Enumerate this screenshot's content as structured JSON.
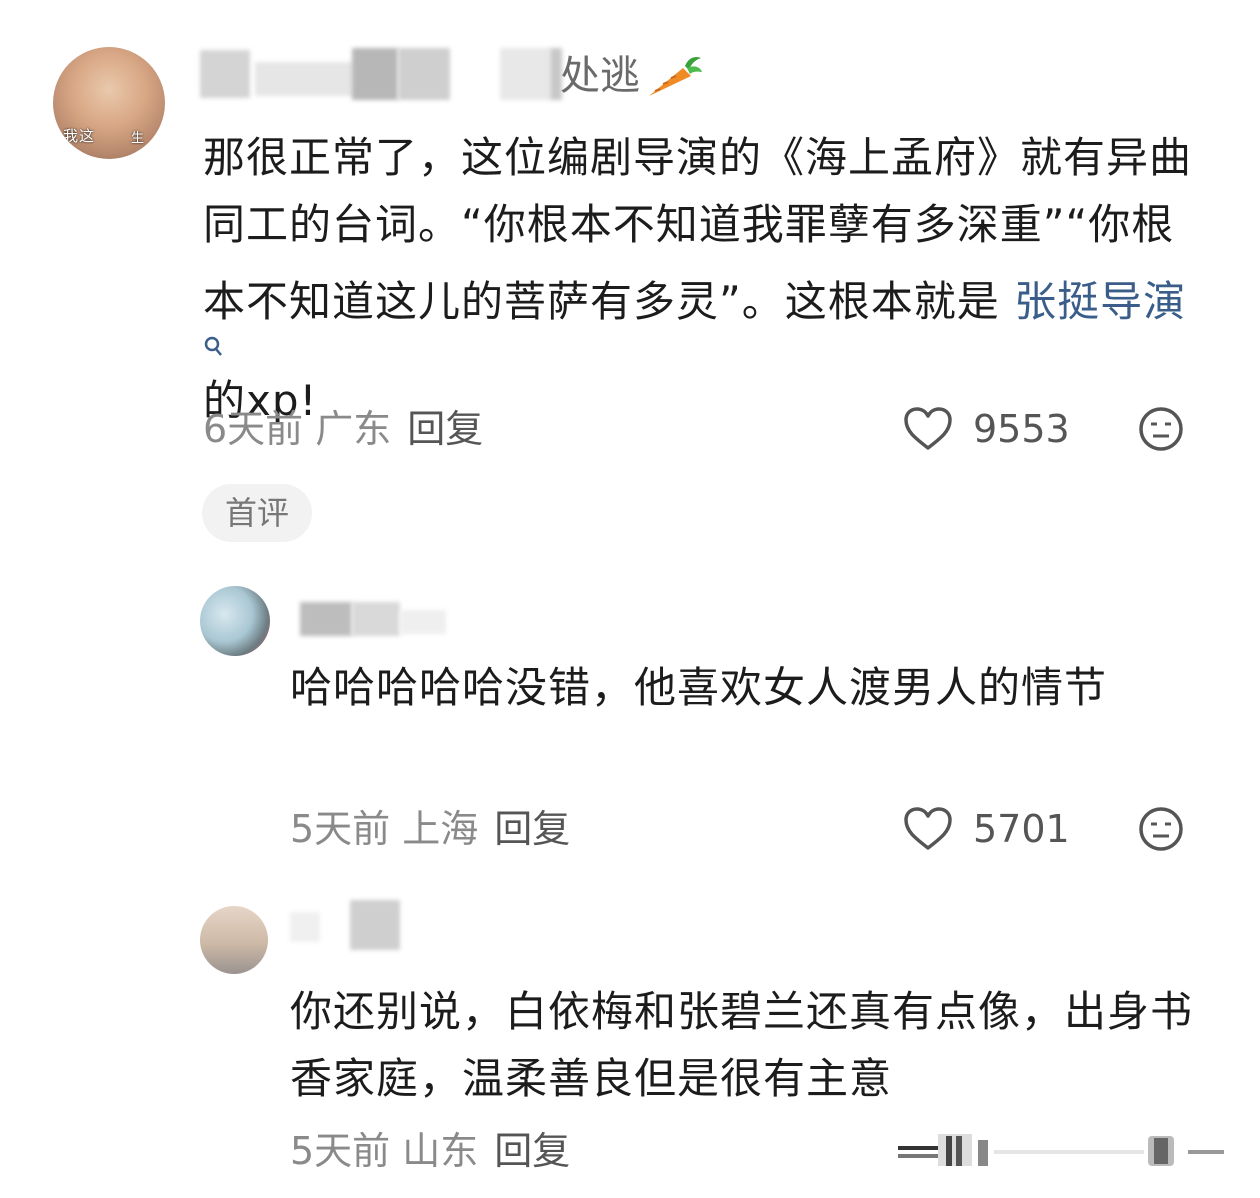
{
  "comment_main": {
    "avatar_overlay_left": "我这",
    "avatar_overlay_right": "生",
    "username_visible": "处逃",
    "text_before_link": "那很正常了，这位编剧导演的《海上孟府》就有异曲同工的台词。“你根本不知道我罪孽有多深重”“你根本不知道这儿的菩萨有多灵”。这根本就是",
    "link_text": "张挺导演",
    "text_after_link": "的xp!",
    "time": "6天前",
    "location": "广东",
    "reply_label": "回复",
    "like_count": "9553",
    "tag": "首评"
  },
  "reply_1": {
    "text": "哈哈哈哈哈没错，他喜欢女人渡男人的情节",
    "time": "5天前",
    "location": "上海",
    "reply_label": "回复",
    "like_count": "5701"
  },
  "reply_2": {
    "text": "你还别说，白依梅和张碧兰还真有点像，出身书香家庭，温柔善良但是很有主意",
    "time": "5天前",
    "location": "山东",
    "reply_label": "回复"
  },
  "icons": {
    "like": "heart-outline-icon",
    "dislike": "neutral-face-icon",
    "search": "search-icon",
    "badge": "carrot-icon"
  },
  "colors": {
    "link": "#3a5d8a",
    "meta": "#8a8a8a",
    "tag_bg": "#f2f2f2"
  }
}
